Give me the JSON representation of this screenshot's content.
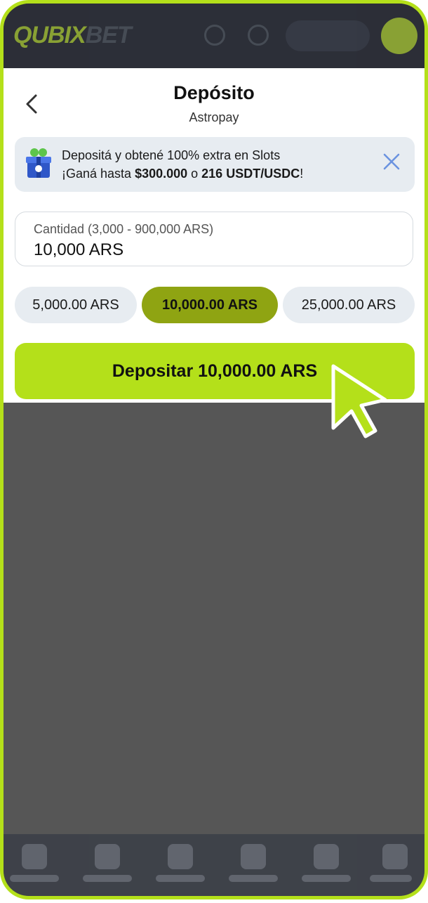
{
  "brand": {
    "accent": "#b4e01a",
    "selected_chip": "#8fa412"
  },
  "header": {
    "logo_text": "QUBIX",
    "logo_suffix": "BET"
  },
  "modal": {
    "title": "Depósito",
    "subtitle": "Astropay",
    "promo": {
      "line1": "Depositá y obtené 100% extra en Slots",
      "line2_prefix": "¡Ganá hasta ",
      "line2_amount": "$300.000",
      "line2_middle": " o ",
      "line2_crypto": "216 USDT/USDC",
      "line2_suffix": "!",
      "icon": "gift-icon"
    },
    "amount": {
      "label": "Cantidad (3,000 - 900,000 ARS)",
      "value": "10,000 ARS"
    },
    "chips": [
      {
        "label": "5,000.00 ARS",
        "selected": false
      },
      {
        "label": "10,000.00 ARS",
        "selected": true
      },
      {
        "label": "25,000.00 ARS",
        "selected": false
      }
    ],
    "deposit_button": "Depositar 10,000.00 ARS"
  }
}
